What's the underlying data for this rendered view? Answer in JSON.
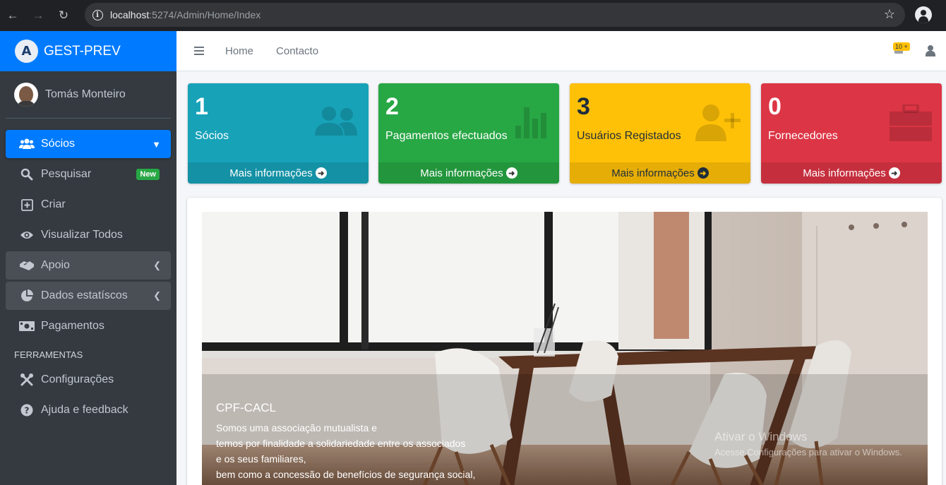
{
  "browser": {
    "url_host": "localhost",
    "url_path": ":5274/Admin/Home/Index"
  },
  "brand": {
    "logo_letter": "A",
    "name": "GEST-PREV"
  },
  "user": {
    "name": "Tomás Monteiro"
  },
  "sidebar": {
    "items": [
      {
        "label": "Sócios",
        "icon": "users-icon"
      },
      {
        "label": "Pesquisar",
        "icon": "search-icon",
        "badge": "New"
      },
      {
        "label": "Criar",
        "icon": "plus-square-icon"
      },
      {
        "label": "Visualizar Todos",
        "icon": "eye-icon"
      },
      {
        "label": "Apoio",
        "icon": "handshake-icon"
      },
      {
        "label": "Dados estatíscos",
        "icon": "pie-chart-icon"
      },
      {
        "label": "Pagamentos",
        "icon": "money-bill-icon"
      }
    ],
    "tools_header": "FERRAMENTAS",
    "tools": [
      {
        "label": "Configurações",
        "icon": "tools-icon"
      },
      {
        "label": "Ajuda e feedback",
        "icon": "question-circle-icon"
      }
    ]
  },
  "topbar": {
    "links": [
      "Home",
      "Contacto"
    ],
    "notification_badge": "10 +"
  },
  "stats": [
    {
      "value": "1",
      "label": "Sócios",
      "link": "Mais informações",
      "color": "#17a2b8"
    },
    {
      "value": "2",
      "label": "Pagamentos efectuados",
      "link": "Mais informações",
      "color": "#28a745"
    },
    {
      "value": "3",
      "label": "Usuários Registados",
      "link": "Mais informações",
      "color": "#ffc107"
    },
    {
      "value": "0",
      "label": "Fornecedores",
      "link": "Mais informações",
      "color": "#dc3545"
    }
  ],
  "carousel": {
    "title": "CPF-CACL",
    "lines": [
      "Somos uma associação mutualista e",
      "temos por finalidade a solidariedade entre os associados",
      "e os seus familiares,",
      "bem como a concessão de benefícios de segurança social,"
    ]
  },
  "watermark": {
    "line1": "Ativar o Windows",
    "line2": "Acesse Configurações para ativar o Windows."
  }
}
